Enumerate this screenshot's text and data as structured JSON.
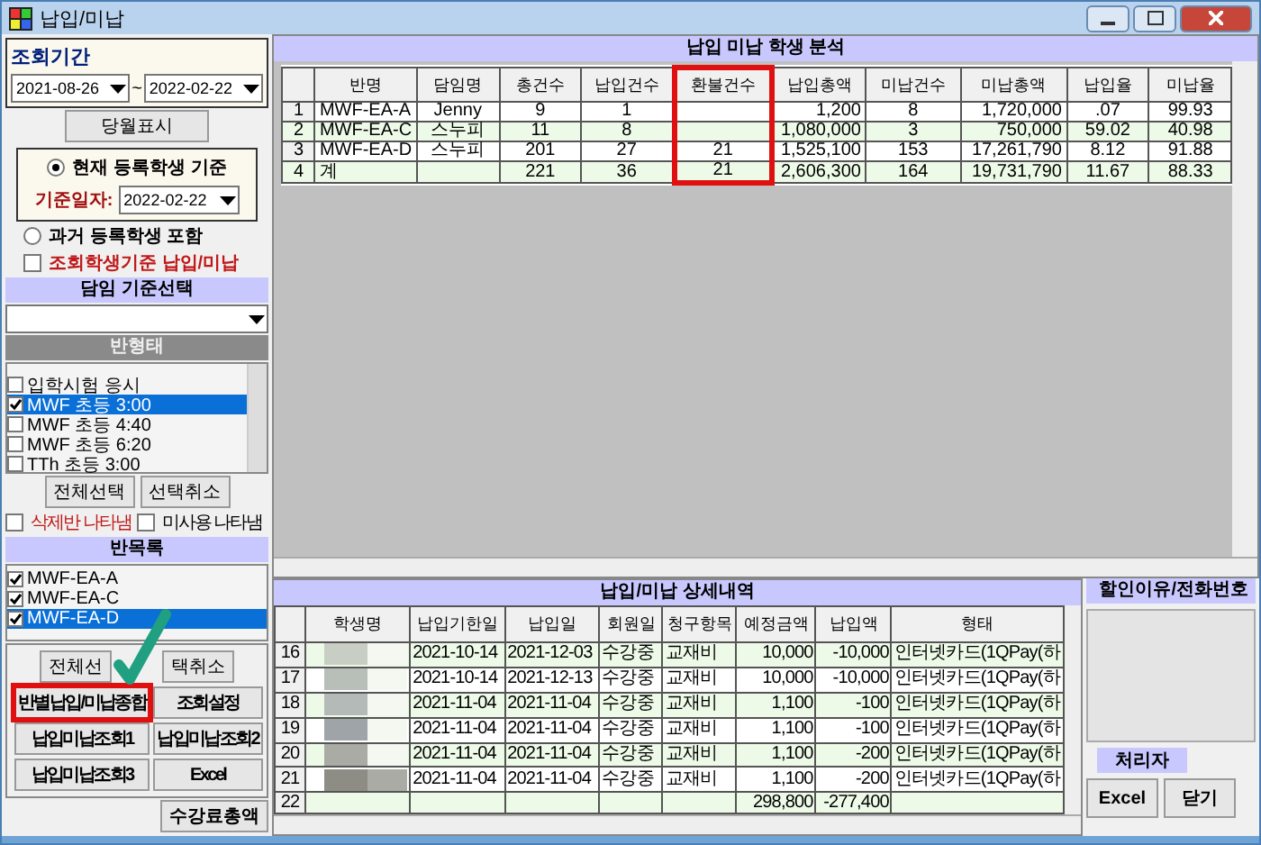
{
  "window": {
    "title": "납입/미납"
  },
  "filters": {
    "period_label": "조회기간",
    "date_from": "2021-08-26",
    "date_to": "2022-02-22",
    "separator": "~",
    "month_button": "당월표시",
    "basis_options": [
      {
        "label": "현재 등록학생 기준",
        "selected": true
      },
      {
        "label": "과거 등록학생 포함",
        "selected": false
      }
    ],
    "basis_date_label": "기준일자:",
    "basis_date": "2022-02-22",
    "student_basis": {
      "label": "조회학생기준 납입/미납",
      "checked": false
    },
    "teacher_header": "담임 기준선택",
    "class_type_header": "반형태",
    "class_types": [
      {
        "label": "입학시험 응시",
        "checked": false,
        "selected": false
      },
      {
        "label": "MWF 초등 3:00",
        "checked": true,
        "selected": true
      },
      {
        "label": "MWF 초등 4:40",
        "checked": false,
        "selected": false
      },
      {
        "label": "MWF 초등 6:20",
        "checked": false,
        "selected": false
      },
      {
        "label": "TTh 초등 3:00",
        "checked": false,
        "selected": false
      }
    ],
    "select_all": "전체선택",
    "deselect": "선택취소",
    "show_options": [
      {
        "label": "삭제반 나타냄",
        "checked": false,
        "kind": "alert"
      },
      {
        "label": "미사용 나타냄",
        "checked": false,
        "kind": "plain"
      }
    ],
    "class_list_header": "반목록",
    "classes": [
      {
        "label": "MWF-EA-A",
        "checked": true,
        "selected": false
      },
      {
        "label": "MWF-EA-C",
        "checked": true,
        "selected": false
      },
      {
        "label": "MWF-EA-D",
        "checked": true,
        "selected": true
      }
    ],
    "select_all_partial": "전체선",
    "deselect_partial": "택취소",
    "action_buttons": [
      {
        "label": "반별납입/미납종합",
        "highlighted": true
      },
      {
        "label": "조회설정",
        "highlighted": false
      },
      {
        "label": "납입미납조회1",
        "highlighted": false
      },
      {
        "label": "납입미납조회2",
        "highlighted": false
      },
      {
        "label": "납입미납조회3",
        "highlighted": false
      },
      {
        "label": "Excel",
        "highlighted": false
      }
    ],
    "total_fee_button": "수강료총액"
  },
  "summary": {
    "title": "납입 미납 학생 분석",
    "columns": [
      {
        "label": "반명",
        "highlighted": false
      },
      {
        "label": "담임명",
        "highlighted": false
      },
      {
        "label": "총건수",
        "highlighted": false
      },
      {
        "label": "납입건수",
        "highlighted": false
      },
      {
        "label": "환불건수",
        "highlighted": true
      },
      {
        "label": "납입총액",
        "highlighted": false
      },
      {
        "label": "미납건수",
        "highlighted": false
      },
      {
        "label": "미납총액",
        "highlighted": false
      },
      {
        "label": "납입율",
        "highlighted": false
      },
      {
        "label": "미납율",
        "highlighted": false
      }
    ],
    "rows": [
      {
        "number": "1",
        "cells": [
          "MWF-EA-A",
          "Jenny",
          "9",
          "1",
          "",
          "1,200",
          "8",
          "1,720,000",
          ".07",
          "99.93"
        ]
      },
      {
        "number": "2",
        "cells": [
          "MWF-EA-C",
          "스누피",
          "11",
          "8",
          "",
          "1,080,000",
          "3",
          "750,000",
          "59.02",
          "40.98"
        ]
      },
      {
        "number": "3",
        "cells": [
          "MWF-EA-D",
          "스누피",
          "201",
          "27",
          "21",
          "1,525,100",
          "153",
          "17,261,790",
          "8.12",
          "91.88"
        ]
      },
      {
        "number": "4",
        "cells": [
          "계",
          "",
          "221",
          "36",
          "21",
          "2,606,300",
          "164",
          "19,731,790",
          "11.67",
          "88.33"
        ]
      }
    ]
  },
  "detail": {
    "title": "납입/미납 상세내역",
    "columns": [
      "학생명",
      "납입기한일",
      "납입일",
      "회원일",
      "청구항목",
      "예정금액",
      "납입액",
      "형태"
    ],
    "rows": [
      {
        "number": "16",
        "kind": "item",
        "cells": [
          "",
          "2021-10-14",
          "2021-12-03",
          "수강중",
          "교재비",
          "10,000",
          "-10,000",
          "인터넷카드(1QPay(하"
        ]
      },
      {
        "number": "17",
        "kind": "item",
        "cells": [
          "",
          "2021-10-14",
          "2021-12-13",
          "수강중",
          "교재비",
          "10,000",
          "-10,000",
          "인터넷카드(1QPay(하"
        ]
      },
      {
        "number": "18",
        "kind": "item",
        "cells": [
          "",
          "2021-11-04",
          "2021-11-04",
          "수강중",
          "교재비",
          "1,100",
          "-100",
          "인터넷카드(1QPay(하"
        ]
      },
      {
        "number": "19",
        "kind": "item",
        "cells": [
          "",
          "2021-11-04",
          "2021-11-04",
          "수강중",
          "교재비",
          "1,100",
          "-100",
          "인터넷카드(1QPay(하"
        ]
      },
      {
        "number": "20",
        "kind": "item",
        "cells": [
          "",
          "2021-11-04",
          "2021-11-04",
          "수강중",
          "교재비",
          "1,100",
          "-200",
          "인터넷카드(1QPay(하"
        ]
      },
      {
        "number": "21",
        "kind": "item",
        "cells": [
          "",
          "2021-11-04",
          "2021-11-04",
          "수강중",
          "교재비",
          "1,100",
          "-200",
          "인터넷카드(1QPay(하"
        ]
      },
      {
        "number": "22",
        "kind": "total",
        "cells": [
          "",
          "",
          "",
          "",
          "",
          "298,800",
          "-277,400",
          ""
        ]
      }
    ]
  },
  "side": {
    "header": "할인이유/전화번호",
    "handler_label": "처리자",
    "buttons": [
      "Excel",
      "닫기"
    ]
  }
}
